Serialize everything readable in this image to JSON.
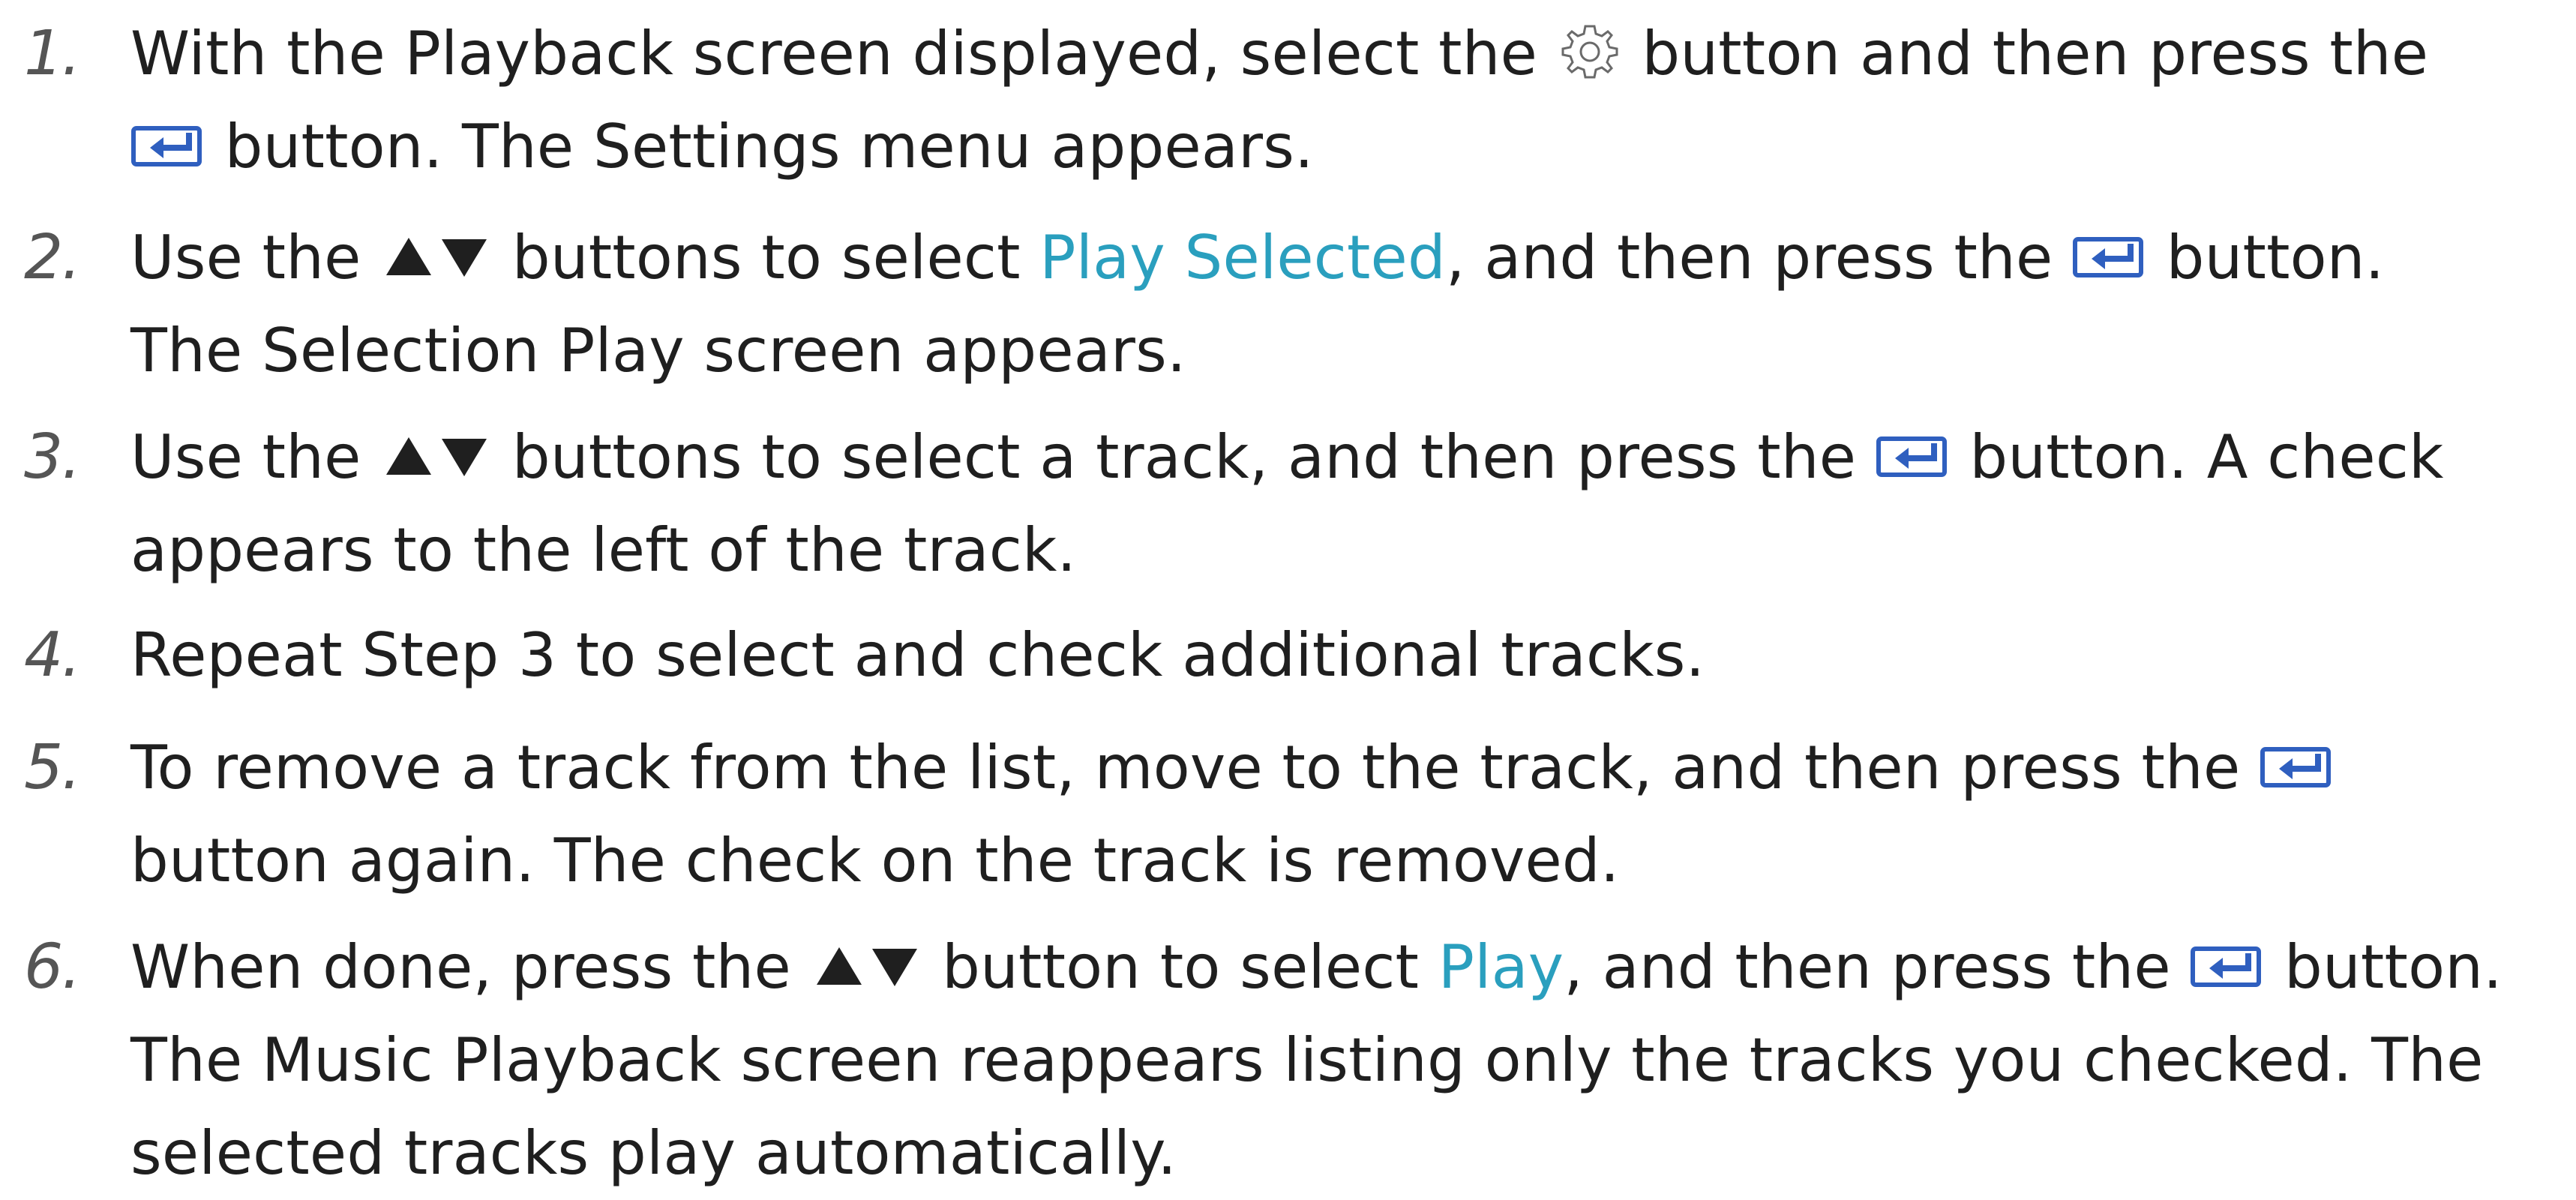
{
  "steps": [
    {
      "number": "1.",
      "parts": {
        "a": "With the Playback screen displayed, select the ",
        "b": " button and then press the",
        "c": " button. The Settings menu appears."
      }
    },
    {
      "number": "2.",
      "parts": {
        "a": "Use the ",
        "b": " buttons to select ",
        "highlight": "Play Selected",
        "c": ", and then press the ",
        "d": " button.",
        "e": "The Selection Play screen appears."
      }
    },
    {
      "number": "3.",
      "parts": {
        "a": "Use the ",
        "b": " buttons to select a track, and then press the ",
        "c": " button. A check",
        "d": "appears to the left of the track."
      }
    },
    {
      "number": "4.",
      "parts": {
        "a": "Repeat Step 3 to select and check additional tracks."
      }
    },
    {
      "number": "5.",
      "parts": {
        "a": "To remove a track from the list, move to the track, and then press the ",
        "b": "button again. The check on the track is removed."
      }
    },
    {
      "number": "6.",
      "parts": {
        "a": "When done, press the ",
        "b": " button to select ",
        "highlight": "Play",
        "c": ", and then press the ",
        "d": " button.",
        "e": "The Music Playback screen reappears listing only the tracks you checked. The",
        "f": "selected tracks play automatically."
      }
    }
  ],
  "icons": {
    "gear": "gear-icon",
    "enter": "enter-icon",
    "updown": "up-down-arrows-icon"
  },
  "colors": {
    "text": "#1f1f1f",
    "number": "#555555",
    "highlight": "#2a9fbe",
    "icon_blue": "#2f5fbf"
  }
}
